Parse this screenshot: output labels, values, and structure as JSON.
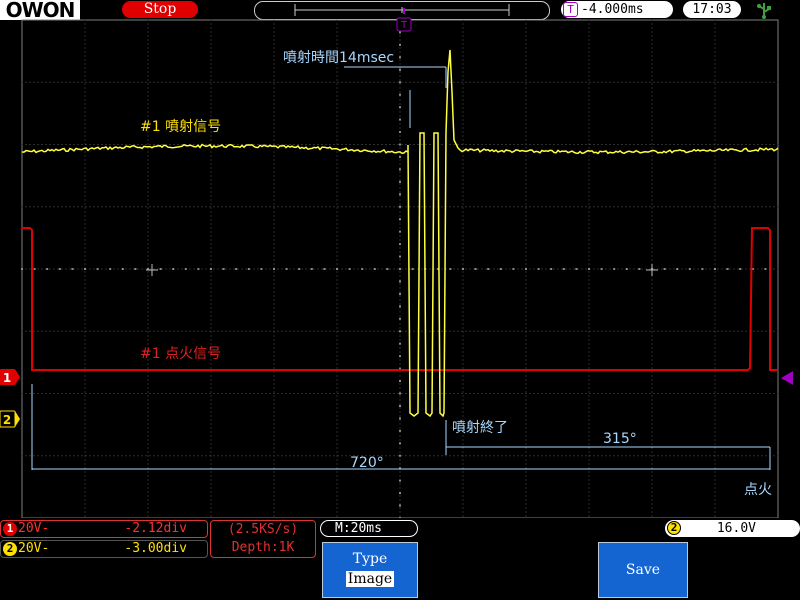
{
  "header": {
    "brand": "OWON",
    "run_state": "Stop",
    "trigger_marker": "T",
    "trigger_offset": "-4.000ms",
    "clock": "17:03",
    "usb_icon": "usb-icon"
  },
  "annotations": {
    "injection_time": "噴射時間14msec",
    "ch1_label": "#1 噴射信号",
    "ch2_label": "#1 点火信号",
    "injection_end": "噴射終了",
    "angle_315": "315°",
    "angle_720": "720°",
    "ignition": "点火"
  },
  "markers": {
    "ch1": "1",
    "ch2": "2"
  },
  "channels": [
    {
      "id": "1",
      "coupling": "20V-",
      "position": "-2.12div",
      "color": "#e00000"
    },
    {
      "id": "2",
      "coupling": "20V-",
      "position": "-3.00div",
      "color": "#ffe000"
    }
  ],
  "acquisition": {
    "sample_rate": "(2.5KS/s)",
    "depth": "Depth:1K"
  },
  "timebase": "M:20ms",
  "trigger_level": {
    "channel": "2",
    "value": "16.0V"
  },
  "softkeys": {
    "type_label": "Type",
    "type_value": "Image",
    "save_label": "Save"
  },
  "colors": {
    "grid": "#7e7e7e",
    "yellow_trace": "#ffff40",
    "red_trace": "#e00000",
    "annotation": "#a8d8ff",
    "softkey": "#1464d2"
  }
}
